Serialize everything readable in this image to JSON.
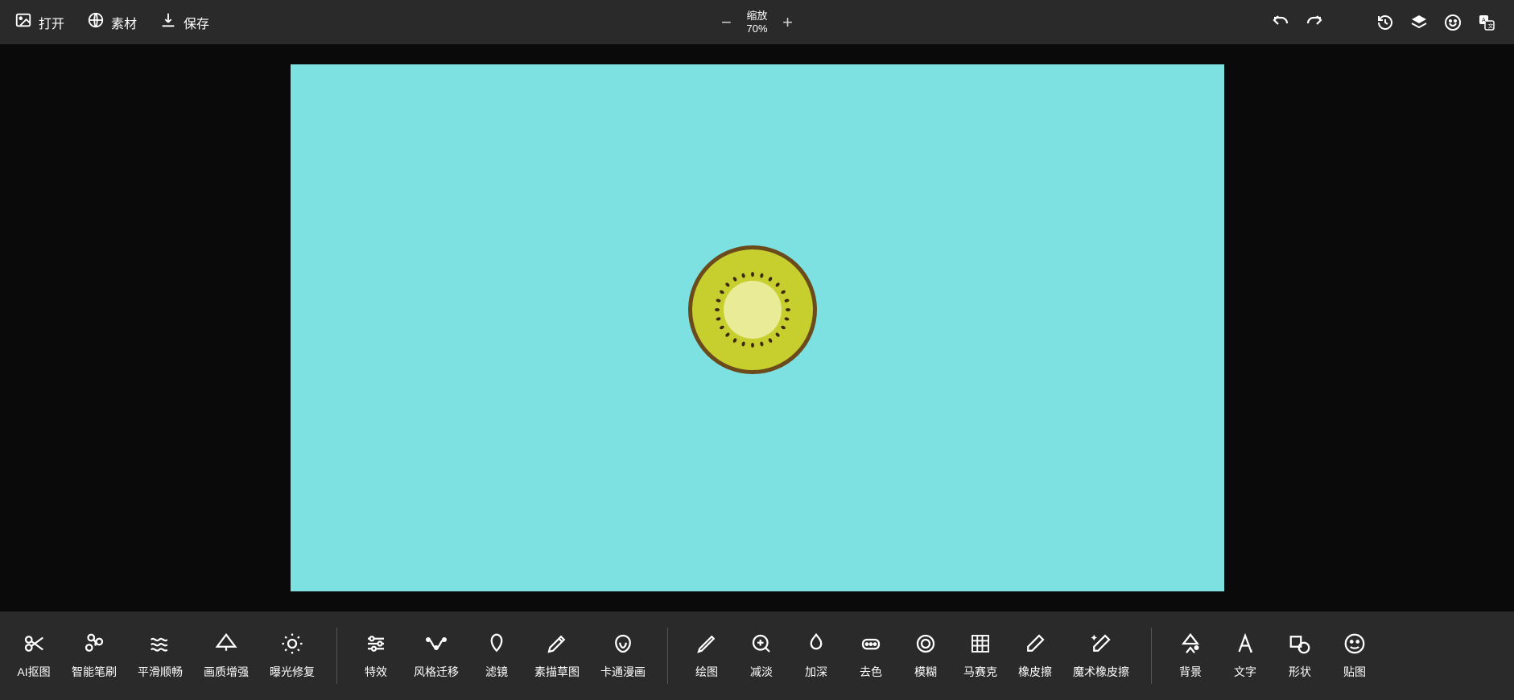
{
  "top": {
    "open": "打开",
    "assets": "素材",
    "save": "保存"
  },
  "zoom": {
    "label": "缩放",
    "value": "70%"
  },
  "tools": {
    "ai_cutout": "AI抠图",
    "smart_brush": "智能笔刷",
    "smooth": "平滑顺畅",
    "enhance": "画质增强",
    "exposure_fix": "曝光修复",
    "effects": "特效",
    "style_transfer": "风格迁移",
    "filter": "滤镜",
    "sketch": "素描草图",
    "cartoon": "卡通漫画",
    "draw": "绘图",
    "dodge": "减淡",
    "burn": "加深",
    "tint": "去色",
    "blur": "模糊",
    "mosaic": "马赛克",
    "eraser": "橡皮擦",
    "magic_eraser": "魔术橡皮擦",
    "background": "背景",
    "text": "文字",
    "shape": "形状",
    "sticker": "贴图"
  }
}
